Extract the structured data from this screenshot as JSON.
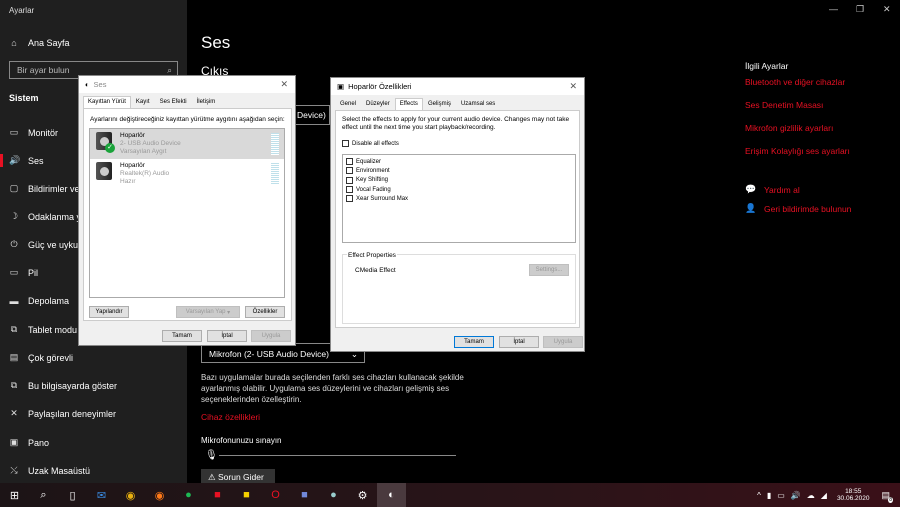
{
  "window": {
    "title": "Ayarlar",
    "min": "—",
    "max": "❐",
    "close": "✕"
  },
  "sidebar": {
    "home": "Ana Sayfa",
    "search_placeholder": "Bir ayar bulun",
    "section": "Sistem",
    "items": [
      {
        "label": "Monitör",
        "icon": "▭"
      },
      {
        "label": "Ses",
        "icon": "🔊"
      },
      {
        "label": "Bildirimler ve eylemler",
        "icon": "▢"
      },
      {
        "label": "Odaklanma yardımı",
        "icon": "☽"
      },
      {
        "label": "Güç ve uyku",
        "icon": "⏻"
      },
      {
        "label": "Pil",
        "icon": "▭"
      },
      {
        "label": "Depolama",
        "icon": "▬"
      },
      {
        "label": "Tablet modu",
        "icon": "⧉"
      },
      {
        "label": "Çok görevli",
        "icon": "▤"
      },
      {
        "label": "Bu bilgisayarda göster",
        "icon": "⧉"
      },
      {
        "label": "Paylaşılan deneyimler",
        "icon": "✕"
      },
      {
        "label": "Pano",
        "icon": "▣"
      },
      {
        "label": "Uzak Masaüstü",
        "icon": "⤯"
      }
    ]
  },
  "main": {
    "title": "Ses",
    "output_heading": "Çıkış",
    "output_device_partial": "Device)",
    "input_device": "Mikrofon (2- USB Audio Device)",
    "info": "Bazı uygulamalar burada seçilenden farklı ses cihazları kullanacak şekilde ayarlanmış olabilir. Uygulama ses düzeylerini ve cihazları gelişmiş ses seçeneklerinden özelleştirin.",
    "device_props": "Cihaz özellikleri",
    "test_mic": "Mikrofonunuzu sınayın",
    "troubleshoot": "Sorun Gider"
  },
  "related": {
    "title": "İlgili Ayarlar",
    "links": [
      "Bluetooth ve diğer cihazlar",
      "Ses Denetim Masası",
      "Mikrofon gizlilik ayarları",
      "Erişim Kolaylığı ses ayarları"
    ],
    "help": "Yardım al",
    "feedback": "Geri bildirimde bulunun"
  },
  "ses_dialog": {
    "title": "Ses",
    "tabs": [
      "Kayıttan Yürüt",
      "Kayıt",
      "Ses Efekti",
      "İletişim"
    ],
    "instruction": "Ayarlarını değiştireceğiniz kayıttan yürütme aygıtını aşağıdan seçin:",
    "devices": [
      {
        "name": "Hoparlör",
        "driver": "2- USB Audio Device",
        "status": "Varsayılan Aygıt"
      },
      {
        "name": "Hoparlör",
        "driver": "Realtek(R) Audio",
        "status": "Hazır"
      }
    ],
    "configure": "Yapılandır",
    "set_default": "Varsayılan Yap",
    "properties": "Özellikler",
    "ok": "Tamam",
    "cancel": "İptal",
    "apply": "Uygula"
  },
  "props_dialog": {
    "title": "Hoparlör Özellikleri",
    "tabs": [
      "Genel",
      "Düzeyler",
      "Effects",
      "Gelişmiş",
      "Uzamsal ses"
    ],
    "instruction": "Select the effects to apply for your current audio device. Changes may not take effect until the next time you start playback/recording.",
    "disable_all": "Disable all effects",
    "effects": [
      "Equalizer",
      "Environment",
      "Key Shifting",
      "Vocal Fading",
      "Xear Surround Max"
    ],
    "effect_props": "Effect Properties",
    "effect_name": "CMedia Effect",
    "settings": "Settings...",
    "ok": "Tamam",
    "cancel": "İptal",
    "apply": "Uygula"
  },
  "taskbar": {
    "time": "18:55",
    "date": "30.06.2020",
    "notif_count": "8"
  }
}
